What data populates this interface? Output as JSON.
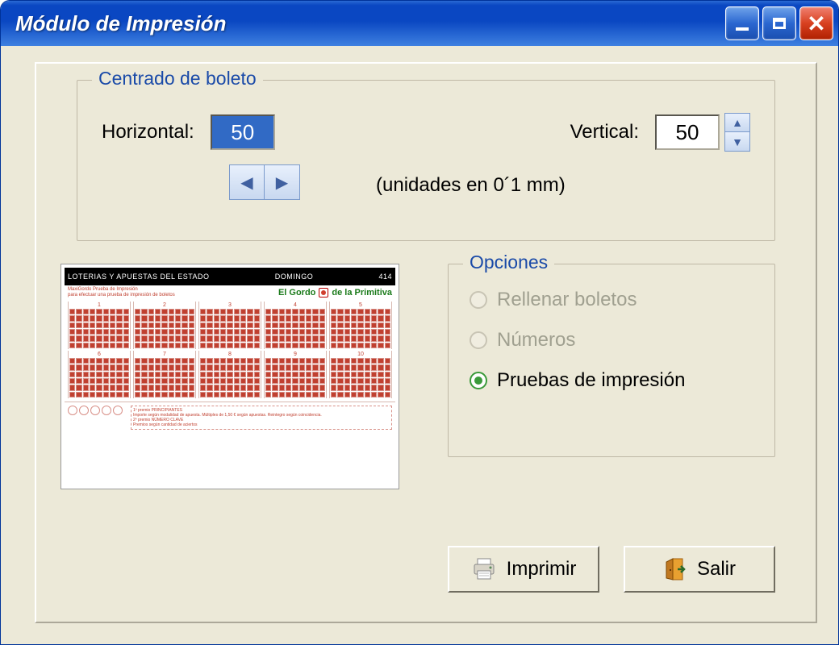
{
  "window": {
    "title": "Módulo de Impresión"
  },
  "centrado": {
    "legend": "Centrado de boleto",
    "horizontal_label": "Horizontal:",
    "horizontal_value": "50",
    "vertical_label": "Vertical:",
    "vertical_value": "50",
    "units_label": "(unidades en 0´1 mm)"
  },
  "ticket": {
    "header_left": "LOTERIAS Y APUESTAS DEL ESTADO",
    "header_mid": "DOMINGO",
    "header_right": "414",
    "brand": "El Gordo        de la Primitiva",
    "tagline1": "MaxiGordo Prueba de Impresión",
    "tagline2": "para efectuar una prueba de impresión de boletos",
    "footer1": "1º premio PRINCIPIANTES",
    "footer2": "Importe según modalidad de apuesta. Múltiples de 1,50 € según apuestas. Reintegro según coincidencia.",
    "footer3": "2º premio NÚMERO CLAVE",
    "footer4": "Premios según cantidad de aciertos"
  },
  "opciones": {
    "legend": "Opciones",
    "items": [
      {
        "label": "Rellenar boletos",
        "enabled": false,
        "selected": false
      },
      {
        "label": "Números",
        "enabled": false,
        "selected": false
      },
      {
        "label": "Pruebas de impresión",
        "enabled": true,
        "selected": true
      }
    ]
  },
  "buttons": {
    "print": "Imprimir",
    "exit": "Salir"
  }
}
